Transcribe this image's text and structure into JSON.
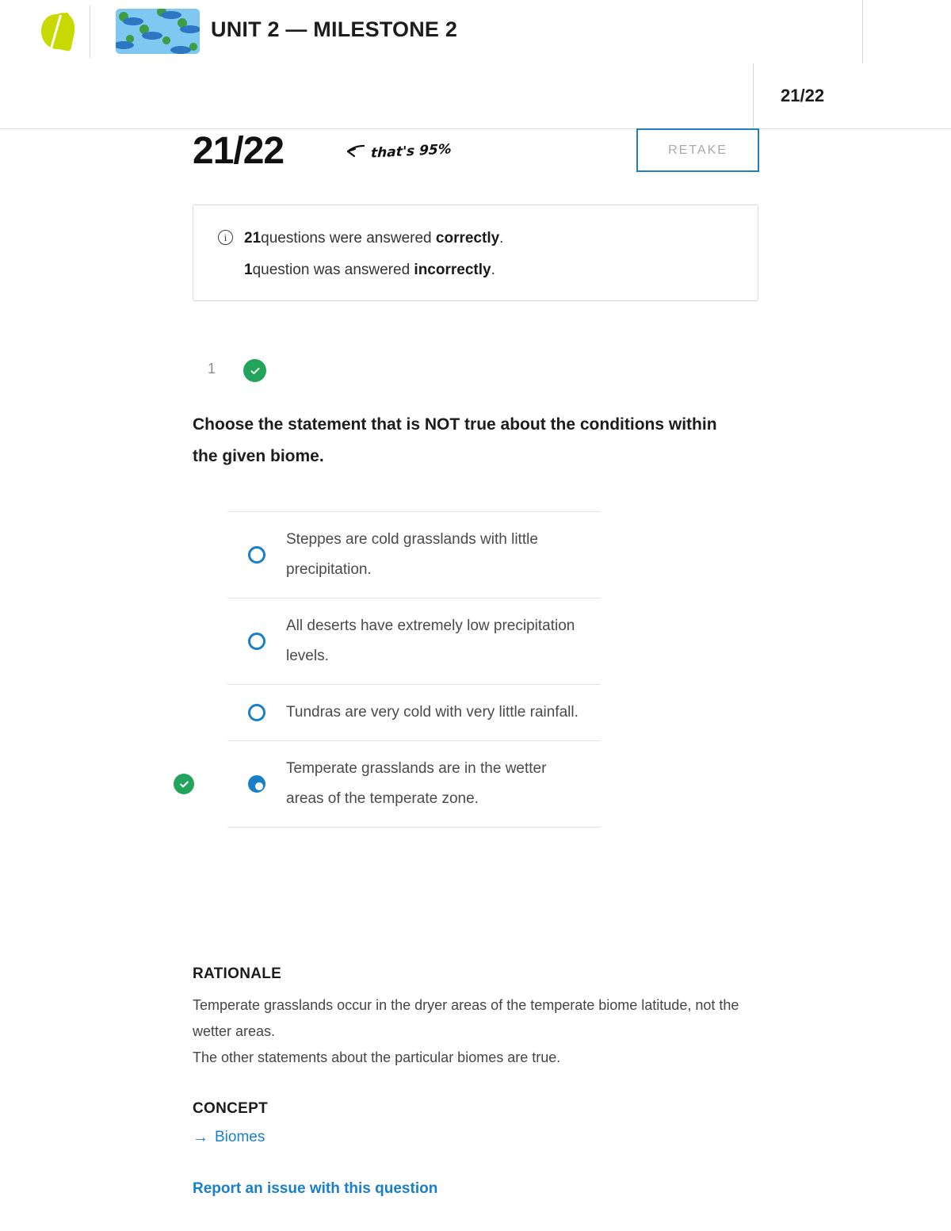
{
  "header": {
    "logo_name": "sophia-logo",
    "thumbnail_name": "unit-thumbnail-biomes",
    "title": "UNIT 2 — MILESTONE 2"
  },
  "subheader": {
    "score": "21/22"
  },
  "score_row": {
    "score": "21/22",
    "annotation": "that's 95%",
    "retake_label": "RETAKE"
  },
  "summary": {
    "icon": "info-icon",
    "line1_count": "21",
    "line1_mid": "questions were answered ",
    "line1_bold": "correctly",
    "line1_end": ".",
    "line2_count": "1",
    "line2_mid": "question was answered ",
    "line2_bold": "incorrectly",
    "line2_end": "."
  },
  "question": {
    "number": "1",
    "status": "correct",
    "status_icon": "check-circle-icon",
    "text": "Choose the statement that is NOT true about the conditions within the given biome.",
    "options": [
      {
        "label": "Steppes are cold grasslands with little precipitation.",
        "selected": false,
        "is_correct_answer": false
      },
      {
        "label": "All deserts have extremely low precipitation levels.",
        "selected": false,
        "is_correct_answer": false
      },
      {
        "label": "Tundras are very cold with very little rainfall.",
        "selected": false,
        "is_correct_answer": false
      },
      {
        "label": "Temperate grasslands are in the wetter areas of the temperate zone.",
        "selected": true,
        "is_correct_answer": true
      }
    ]
  },
  "rationale": {
    "heading": "RATIONALE",
    "body": "Temperate grasslands occur in the dryer areas of the temperate biome latitude, not the wetter areas.\nThe other statements about the particular biomes are true."
  },
  "concept": {
    "heading": "CONCEPT",
    "arrow": "→",
    "link_label": "Biomes"
  },
  "report": {
    "label": "Report an issue with this question"
  },
  "colors": {
    "accent_blue": "#1a7fc9",
    "success_green": "#22a45d",
    "logo_green": "#c8d900",
    "muted_gray": "#a9a9a9"
  }
}
